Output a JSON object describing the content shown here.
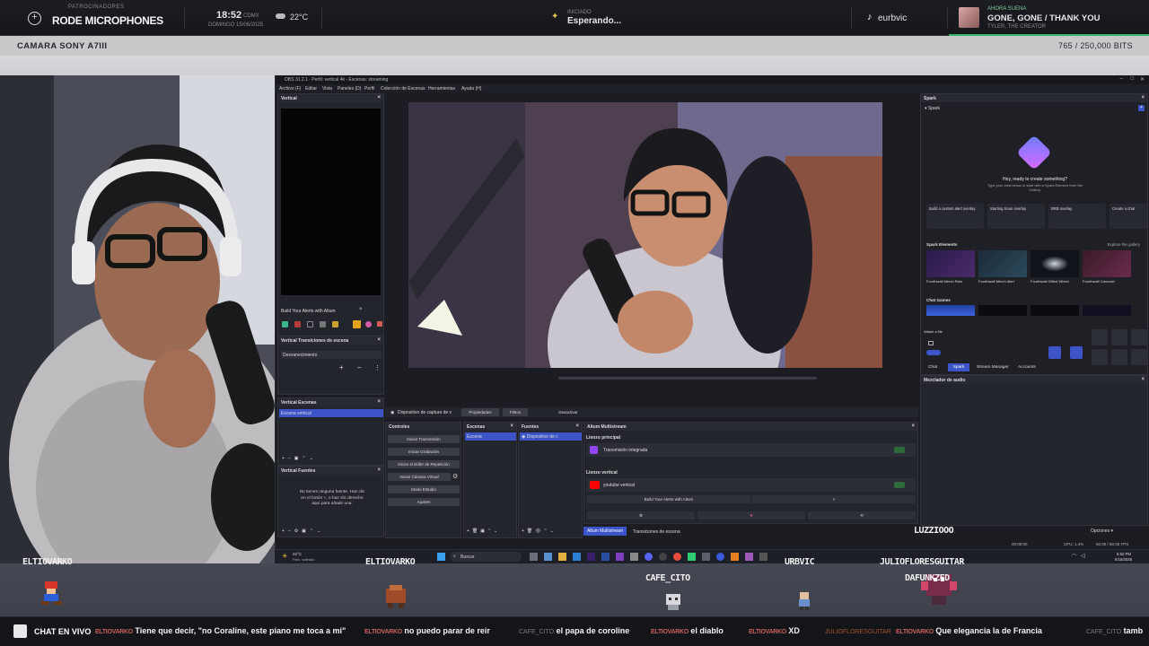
{
  "topbar": {
    "sponsor_caption": "PATROCINADORES",
    "sponsor_name": "RODE MICROPHONES",
    "time": "18:52",
    "tz": "CDMX",
    "date": "DOMINGO 15/06/2025",
    "weather": "22°C",
    "status_caption": "INICIADO",
    "status": "Esperando...",
    "tiktok_handle": "eurbvic",
    "music_caption": "AHORA SUENA",
    "song_title": "GONE, GONE / THANK YOU",
    "song_artist": "TYLER, THE CREATOR"
  },
  "camera_bar": {
    "label": "CAMARA SONY A7III",
    "bits": "765 / 250,000 BITS"
  },
  "obs": {
    "title": "OBS 31.2.1 - Perfil: vertical 4k - Escenas: streaming",
    "menu": [
      "Archivo (F)",
      "Editar",
      "Vista",
      "Paneles (D)",
      "Perfil",
      "Colección de Escenas",
      "Herramientas",
      "Ayuda (H)"
    ],
    "vertical_panel": {
      "title": "Vertical",
      "build_label": "Build Your Alerts with Altum"
    },
    "transitions_panel": {
      "title": "Vertical Transiciones de escena",
      "value": "Desvanecimiento"
    },
    "scenes_panel": {
      "title": "Vertical Escenas",
      "item": "Escena vertical"
    },
    "sources_panel": {
      "title": "Vertical Fuentes",
      "empty_text": "No tienes ninguna fuente. Haz clic en el botón +, o haz clic derecho aquí para añadir una."
    },
    "toolbar": {
      "source": "Dispositivo de captura de v",
      "props": "Propiedades",
      "filters": "Filtros",
      "deactivate": "Desactivar"
    },
    "controls": {
      "title": "Controles",
      "buttons": [
        "Iniciar Transmisión",
        "Iniciar Grabación",
        "Iniciar el Búfer de Repetición",
        "Iniciar Cámara Virtual",
        "Modo Estudio",
        "Ajustes"
      ]
    },
    "scenes2": {
      "title": "Escenas",
      "item": "Escena"
    },
    "sources2": {
      "title": "Fuentes",
      "item": "Dispositivo de c"
    },
    "altum": {
      "title": "Altum Multistream",
      "main_canvas": "Lienzo principal",
      "integrated": "Transmisión integrada",
      "vertical_canvas": "Lienzo vertical",
      "youtube": "youtube vertical",
      "build_label": "Build Your Alerts with Altum",
      "x_glyph": "×"
    },
    "tabs": [
      "Altum Multistream",
      "Transiciones de escena"
    ],
    "spark": {
      "title": "Spark",
      "sub": "Spark",
      "greeting": "Hey, ready to create something?",
      "hint": "Type your idea below or start with a Spark Element from the Gallery.",
      "cards": [
        "Build a custom alert overlay",
        "Starting Soon overlay",
        "BRB overlay",
        "Create a chat"
      ],
      "elements_title": "Spark Elements",
      "explore": "Explore the gallery",
      "elements": [
        "Fourthwall Merch Rain",
        "Fourthwall Merch Alert",
        "Fourthwall Gifted Wheel",
        "Fourthwall Carousel"
      ],
      "chat_games": "Chat Games",
      "attach": "Attach a file",
      "tabs": [
        "Chat",
        "Spark",
        "Stream Manager",
        "Accounts"
      ]
    },
    "audio_mixer": "Mezclador de audio",
    "status": {
      "time": "00:00:00",
      "cpu": "CPU: 1.4%",
      "fps": "60.00 / 60.00 FPS"
    },
    "options": "Opciones"
  },
  "taskbar": {
    "weather": "22°C",
    "weather_desc": "Parc. soleado",
    "search": "Buscar",
    "time": "6:52 PM",
    "date": "6/15/2025"
  },
  "overlay": {
    "chatter_labels": [
      "ELTIOVARKO",
      "ELTIOVARKO",
      "CAFE_CITO",
      "URBVIC",
      "JULIOFLORESGUITAR",
      "DAFUNKZED",
      "LUZZIOOO"
    ]
  },
  "chat_bar": {
    "label": "CHAT EN VIVO",
    "messages": [
      {
        "user": "ELTIOVARKO",
        "text": "Tiene que decir, \"no Coraline, este piano me toca a mi\""
      },
      {
        "user": "ELTIOVARKO",
        "text": "no puedo parar de reir"
      },
      {
        "user": "CAFE_CITO",
        "text": "el papa de coroline"
      },
      {
        "user": "ELTIOVARKO",
        "text": "el diablo"
      },
      {
        "user": "ELTIOVARKO",
        "text": "XD"
      },
      {
        "user": "JULIOFLORESGUITAR",
        "text": ""
      },
      {
        "user": "ELTIOVARKO",
        "text": "Que elegancia la de Francia"
      },
      {
        "user": "CAFE_CITO",
        "text": "tamb"
      }
    ]
  },
  "colors": {
    "accent_blue": "#3c54c8",
    "music_green": "#36b36f",
    "username_red": "#c65e5e"
  }
}
